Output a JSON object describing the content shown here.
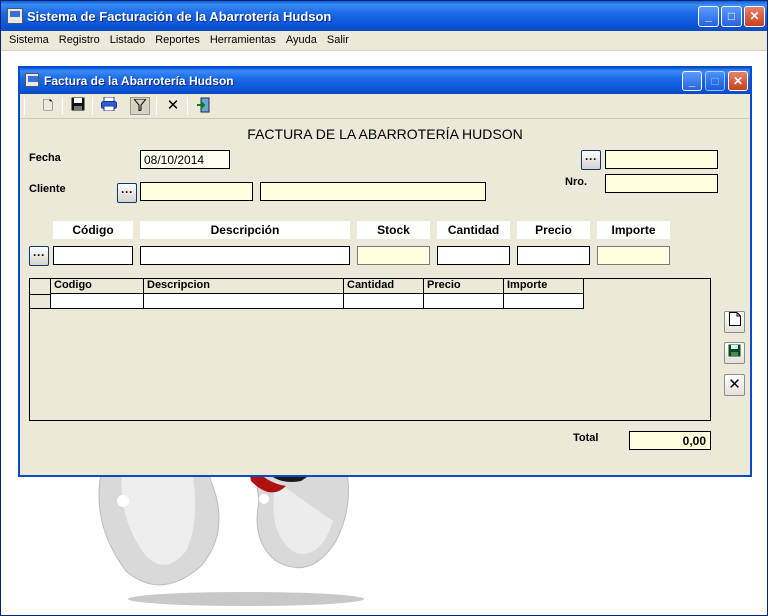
{
  "app": {
    "title": "Sistema de Facturación de la Abarrotería Hudson",
    "menu": [
      "Sistema",
      "Registro",
      "Listado",
      "Reportes",
      "Herramientas",
      "Ayuda",
      "Salir"
    ]
  },
  "window": {
    "title": "Factura de la Abarrotería Hudson",
    "toolbar_icons": [
      "new-document-icon",
      "save-icon",
      "print-icon",
      "filter-icon",
      "delete-icon",
      "exit-icon"
    ]
  },
  "form": {
    "heading": "FACTURA DE LA ABARROTERÍA HUDSON",
    "fecha_label": "Fecha",
    "fecha_value": "08/10/2014",
    "cliente_label": "Cliente",
    "nro_label": "Nro.",
    "lookup_glyph": "···",
    "item_headers": [
      "Código",
      "Descripción",
      "Stock",
      "Cantidad",
      "Precio",
      "Importe"
    ]
  },
  "grid": {
    "columns": [
      "Codigo",
      "Descripcion",
      "Cantidad",
      "Precio",
      "Importe"
    ]
  },
  "totals": {
    "label": "Total",
    "value": "0,00"
  },
  "colors": {
    "titlebar": "#0a55d8",
    "window_bg": "#ece9d8",
    "readonly_field": "#ffffe0"
  }
}
